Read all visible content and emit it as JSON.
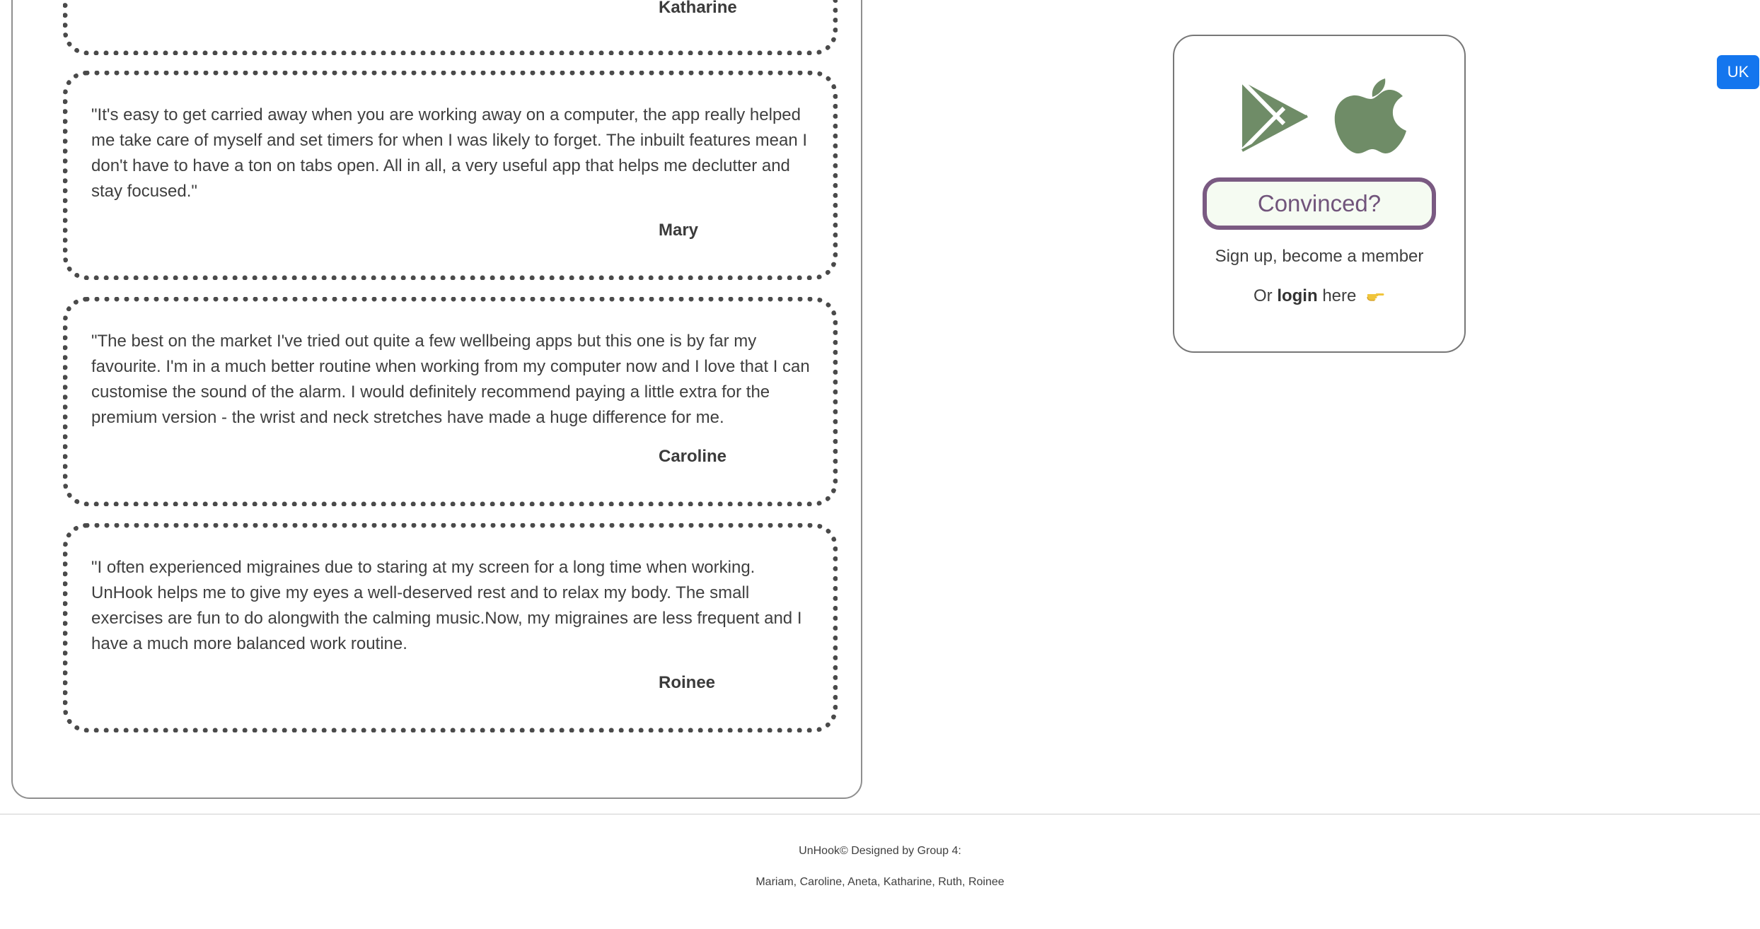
{
  "testimonials": [
    {
      "author": "Katharine"
    },
    {
      "quote": "\"It's easy to get carried away when you are working away on a computer, the app really helped me take care of myself and set timers for when I was likely to forget. The inbuilt features mean I don't have to have a ton on tabs open. All in all, a very useful app that helps me declutter and stay focused.\"",
      "author": "Mary"
    },
    {
      "quote": "\"The best on the market I've tried out quite a few wellbeing apps but this one is by far my favourite. I'm in a much better routine when working from my computer now and I love that I can customise the sound of the alarm. I would definitely recommend paying a little extra for the premium version - the wrist and neck stretches have made a huge difference for me.",
      "author": "Caroline"
    },
    {
      "quote": "\"I often experienced migraines due to staring at my screen for a long time when working. UnHook helps me to give my eyes a well-deserved rest and to relax my body. The small exercises are fun to do alongwith the calming music.Now, my migraines are less frequent and I have a much more balanced work routine.",
      "author": "Roinee"
    }
  ],
  "signup": {
    "store_icons": [
      "google-play-icon",
      "apple-icon"
    ],
    "button_label": "Convinced?",
    "text": "Sign up, become a member",
    "login_prefix": "Or",
    "login_link": "login",
    "login_suffix": "here",
    "pointer_icon": "pointing-hand-icon"
  },
  "language_button": "UK",
  "footer": {
    "title": "UnHook© Designed by Group 4:",
    "members": "Mariam, Caroline, Aneta, Katharine, Ruth, Roinee"
  },
  "colors": {
    "accent_icon": "#6f8c67",
    "button_border": "#7a5a82",
    "button_background": "#f5fbf2",
    "language_button": "#1476ee"
  }
}
